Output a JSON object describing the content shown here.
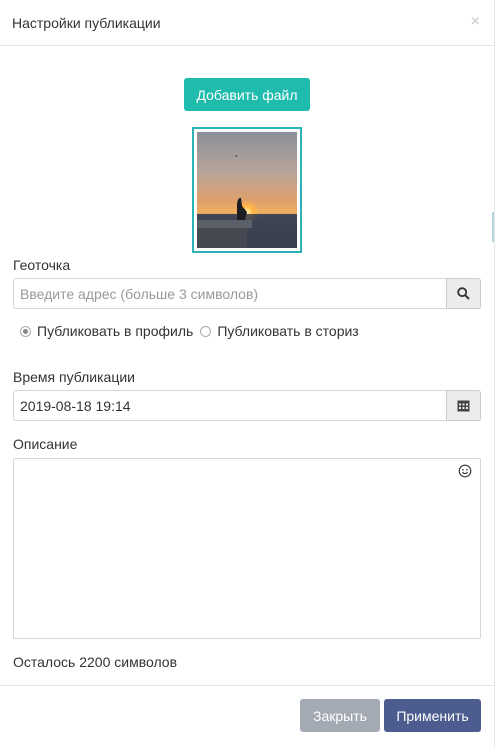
{
  "modal": {
    "title": "Настройки публикации",
    "close_glyph": "×"
  },
  "media": {
    "add_file_label": "Добавить файл"
  },
  "geo": {
    "label": "Геоточка",
    "placeholder": "Введите адрес (больше 3 символов)",
    "search_icon": "search-icon"
  },
  "publish_target": {
    "options": [
      {
        "label": "Публиковать в профиль",
        "checked": true
      },
      {
        "label": "Публиковать в сториз",
        "checked": false
      }
    ]
  },
  "schedule": {
    "label": "Время публикации",
    "value": "2019-08-18 19:14",
    "calendar_icon": "calendar-icon"
  },
  "description": {
    "label": "Описание",
    "value": "",
    "emoji_icon": "smiley-icon",
    "remaining_text": "Осталось 2200 символов"
  },
  "footer": {
    "close_label": "Закрыть",
    "apply_label": "Применить"
  },
  "colors": {
    "accent_teal": "#1fbcad",
    "apply_blue": "#4d5c8f",
    "close_gray": "#a3aab3"
  }
}
